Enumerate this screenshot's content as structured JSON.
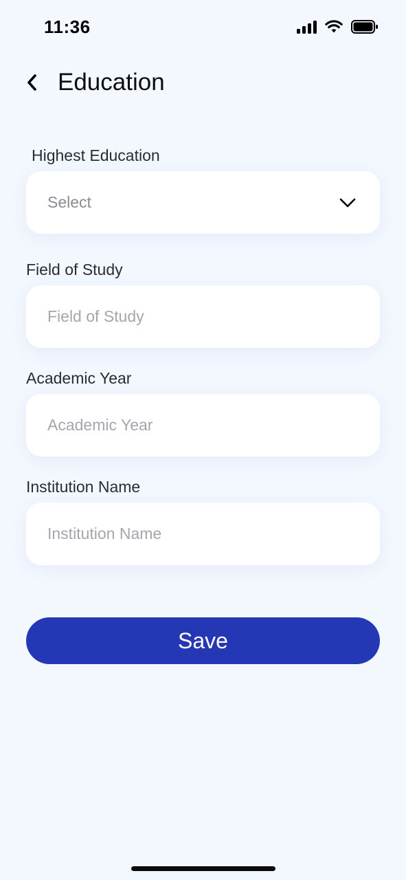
{
  "status_bar": {
    "time": "11:36",
    "icons": [
      "signal-icon",
      "wifi-icon",
      "battery-icon"
    ]
  },
  "header": {
    "title": "Education",
    "back_icon": "chevron-left-icon"
  },
  "form": {
    "highest_education": {
      "label": "Highest Education",
      "value": "Select",
      "icon": "chevron-down-icon"
    },
    "field_of_study": {
      "label": "Field of Study",
      "placeholder": "Field of Study",
      "value": ""
    },
    "academic_year": {
      "label": "Academic Year",
      "placeholder": "Academic Year",
      "value": ""
    },
    "institution_name": {
      "label": "Institution Name",
      "placeholder": "Institution Name",
      "value": ""
    }
  },
  "actions": {
    "save_label": "Save"
  },
  "colors": {
    "background": "#f3f7fe",
    "primary": "#2437b5",
    "field": "#ffffff"
  }
}
